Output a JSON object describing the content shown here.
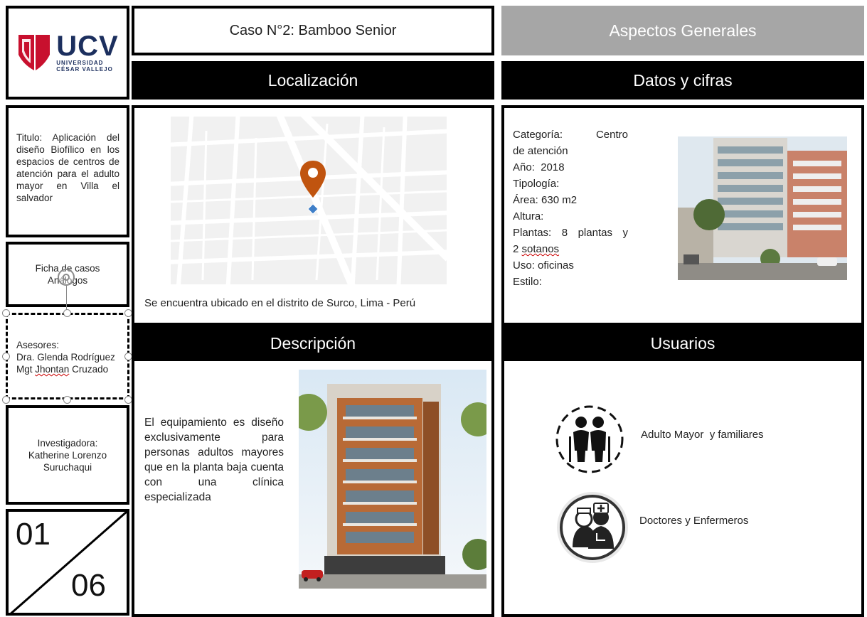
{
  "logo": {
    "acronym": "UCV",
    "line1": "UNIVERSIDAD",
    "line2": "CÉSAR VALLEJO",
    "brand_color": "#c8102e"
  },
  "case_title": "Caso N°2: Bamboo Senior",
  "general_header": "Aspectos Generales",
  "sections": {
    "location": "Localización",
    "data": "Datos y cifras",
    "description": "Descripción",
    "users": "Usuarios"
  },
  "sidebar": {
    "title_text": "Titulo: Aplicación del diseño Biofílico en los espacios de centros de atención para el adulto mayor en Villa el salvador",
    "ficha_line1": "Ficha de casos",
    "ficha_line2": "Análogos",
    "advisors_label": "Asesores:",
    "advisor1": "Dra. Glenda Rodríguez",
    "advisor2_prefix": "Mgt ",
    "advisor2_name": "Jhontan",
    "advisor2_surname": " Cruzado",
    "researcher_label": "Investigadora:",
    "researcher_name": "Katherine Lorenzo Suruchaqui",
    "page_current": "01",
    "page_total": "06"
  },
  "location_text": "Se encuentra ubicado en el distrito de Surco, Lima - Perú",
  "map": {
    "pin_color": "#c0540f",
    "marker_color": "#3f7fc8"
  },
  "data_list": [
    {
      "label": "Categoría:",
      "value": "Centro de atención"
    },
    {
      "label": "Año:",
      "value": "2018"
    },
    {
      "label": "Tipología:",
      "value": ""
    },
    {
      "label": "Área:",
      "value": "630 m2"
    },
    {
      "label": "Altura:",
      "value": ""
    },
    {
      "label": "Plantas:",
      "value": "8 plantas y 2 sotanos"
    },
    {
      "label": "Uso:",
      "value": "oficinas"
    },
    {
      "label": "Estilo:",
      "value": ""
    }
  ],
  "description_text": "El equipamiento es diseño exclusivamente para personas adultos mayores que en la planta baja cuenta con una clínica especializada",
  "users": [
    {
      "label": "Adulto Mayor  y familiares",
      "icon": "elderly-couple-icon"
    },
    {
      "label": "Doctores y Enfermeros",
      "icon": "doctor-nurse-icon"
    }
  ]
}
